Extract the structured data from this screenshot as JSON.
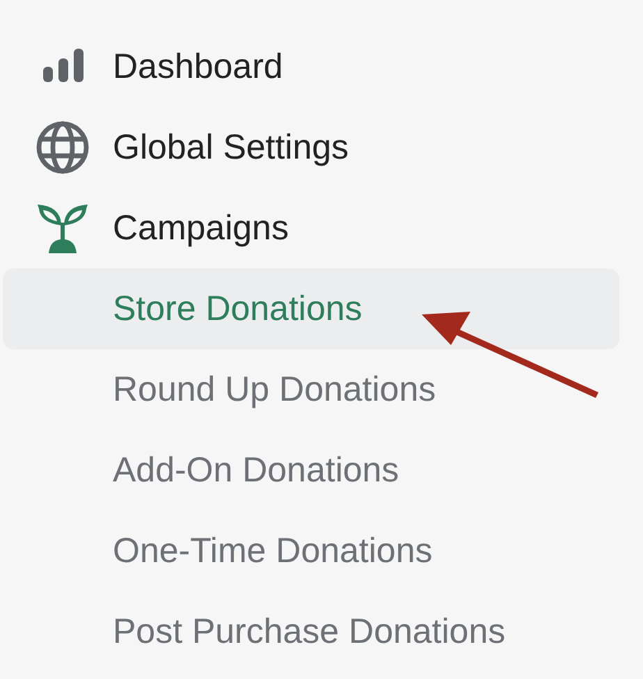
{
  "nav": [
    {
      "label": "Dashboard",
      "selected": false
    },
    {
      "label": "Global Settings",
      "selected": false
    },
    {
      "label": "Campaigns",
      "selected": false,
      "expanded": true,
      "children": [
        {
          "label": "Store Donations",
          "selected": true
        },
        {
          "label": "Round Up Donations",
          "selected": false
        },
        {
          "label": "Add-On Donations",
          "selected": false
        },
        {
          "label": "One-Time Donations",
          "selected": false
        },
        {
          "label": "Post Purchase Donations",
          "selected": false
        }
      ]
    }
  ],
  "pointer_arrow": true
}
